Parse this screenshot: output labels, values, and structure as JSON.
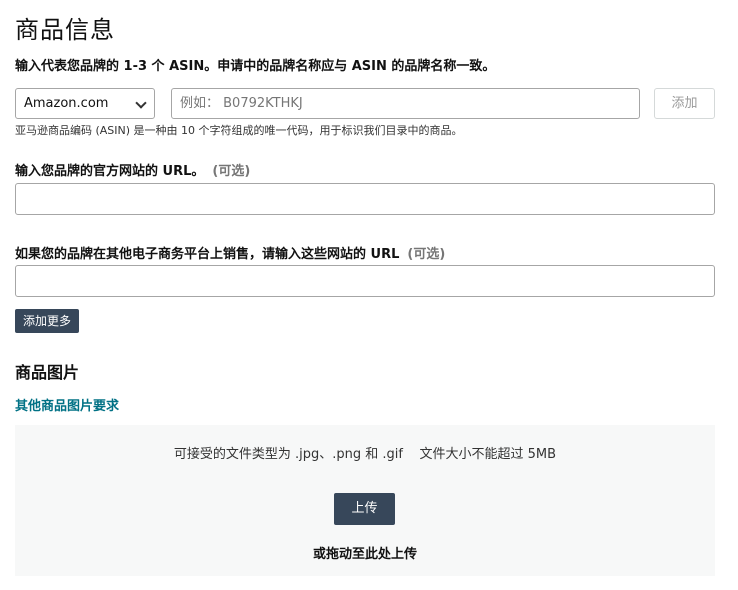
{
  "page": {
    "title": "商品信息"
  },
  "asin": {
    "label": "输入代表您品牌的 1-3 个 ASIN。申请中的品牌名称应与 ASIN 的品牌名称一致。",
    "marketplace_value": "Amazon.com",
    "placeholder": "例如： B0792KTHKJ",
    "add_label": "添加",
    "hint": "亚马逊商品编码 (ASIN) 是一种由 10 个字符组成的唯一代码，用于标识我们目录中的商品。"
  },
  "website": {
    "label": "输入您品牌的官方网站的 URL。",
    "optional": "(可选)",
    "value": ""
  },
  "ecommerce": {
    "label": "如果您的品牌在其他电子商务平台上销售，请输入这些网站的 URL",
    "optional": "(可选)",
    "value": "",
    "add_more_label": "添加更多"
  },
  "images": {
    "section_title": "商品图片",
    "requirements_link": "其他商品图片要求",
    "file_types": "可接受的文件类型为 .jpg、.png 和 .gif    文件大小不能超过 5MB",
    "upload_label": "上传",
    "drag_text": "或拖动至此处上传"
  },
  "colors": {
    "dark_button": "#37475a",
    "link": "#007185",
    "dropzone_bg": "#f7f8f8"
  },
  "icons": {
    "marketplace_dropdown": "chevron-down-icon"
  }
}
